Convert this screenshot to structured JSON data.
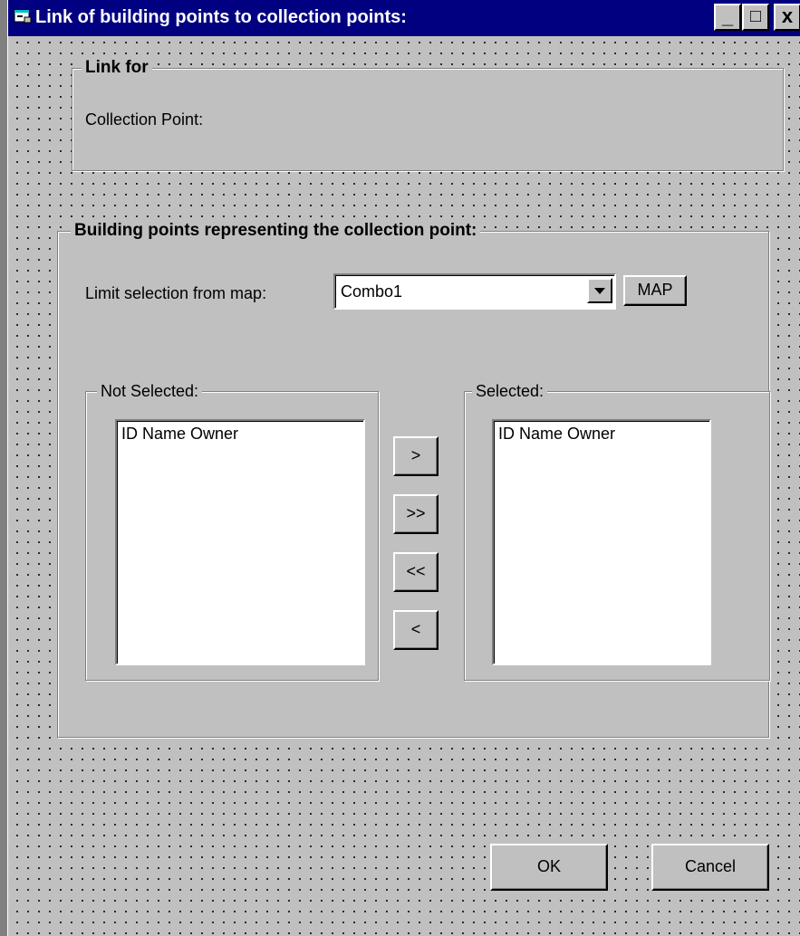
{
  "window": {
    "title": "Link of building points to collection points:",
    "minimize_glyph": "_",
    "maximize_glyph": "□",
    "close_glyph": "x",
    "icon": "form-icon",
    "title_bar_color": "#000080",
    "face_color": "#c0c0c0"
  },
  "link_for": {
    "legend": "Link for",
    "collection_point_label": "Collection Point:"
  },
  "building_points": {
    "legend": "Building points representing the collection point:",
    "limit_label": "Limit selection from map:",
    "combo_value": "Combo1",
    "map_button": "MAP"
  },
  "not_selected": {
    "legend": "Not Selected:",
    "header": "ID Name Owner"
  },
  "selected": {
    "legend": "Selected:",
    "header": "ID Name Owner"
  },
  "transfer_buttons": {
    "add_one": ">",
    "add_all": ">>",
    "remove_all": "<<",
    "remove_one": "<"
  },
  "footer": {
    "ok": "OK",
    "cancel": "Cancel"
  }
}
